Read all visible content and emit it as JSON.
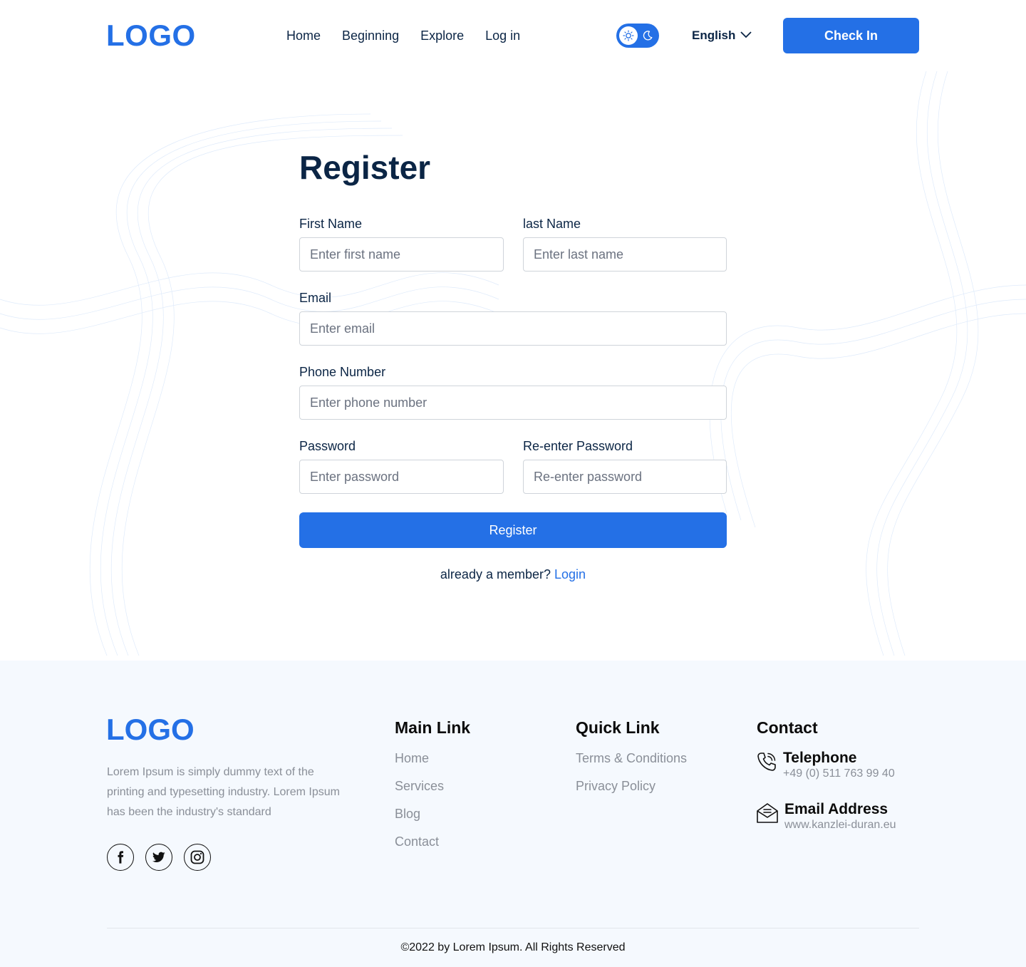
{
  "header": {
    "logo": "LOGO",
    "nav": [
      "Home",
      "Beginning",
      "Explore",
      "Log in"
    ],
    "theme_icons": [
      "sun-icon",
      "moon-icon"
    ],
    "language": "English",
    "checkin_label": "Check In"
  },
  "form": {
    "title": "Register",
    "first_name": {
      "label": "First Name",
      "placeholder": "Enter first name"
    },
    "last_name": {
      "label": "last Name",
      "placeholder": "Enter last name"
    },
    "email": {
      "label": "Email",
      "placeholder": "Enter email"
    },
    "phone": {
      "label": "Phone Number",
      "placeholder": "Enter phone number"
    },
    "password": {
      "label": "Password",
      "placeholder": "Enter password"
    },
    "repassword": {
      "label": "Re-enter Password",
      "placeholder": "Re-enter password"
    },
    "submit_label": "Register",
    "member_text": "already a member?",
    "login_link": "Login"
  },
  "footer": {
    "logo": "LOGO",
    "about": "Lorem Ipsum is simply dummy text of the printing and typesetting industry. Lorem Ipsum has been the industry's standard",
    "socials": [
      "facebook-icon",
      "twitter-icon",
      "instagram-icon"
    ],
    "main_link": {
      "title": "Main Link",
      "links": [
        "Home",
        "Services",
        "Blog",
        "Contact"
      ]
    },
    "quick_link": {
      "title": "Quick Link",
      "links": [
        "Terms & Conditions",
        "Privacy Policy"
      ]
    },
    "contact": {
      "title": "Contact",
      "telephone_label": "Telephone",
      "telephone_value": "+49 (0) 511 763 99 40",
      "email_label": "Email Address",
      "email_value": "www.kanzlei-duran.eu"
    },
    "copyright": "©2022 by Lorem Ipsum. All Rights Reserved"
  },
  "colors": {
    "accent": "#2470e6",
    "text": "#0b2545",
    "muted": "#8a8f98",
    "footer_bg": "#f5f9fe"
  }
}
